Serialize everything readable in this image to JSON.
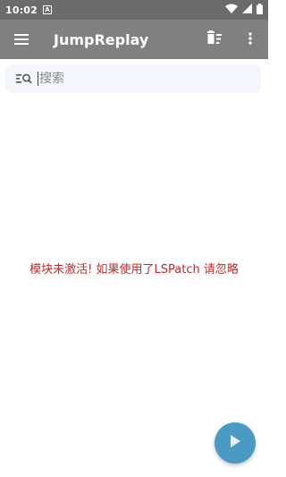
{
  "status_bar": {
    "time": "10:02",
    "notification_letter": "A",
    "icons": [
      "wifi-icon",
      "signal-icon",
      "battery-icon"
    ]
  },
  "app_bar": {
    "title": "JumpReplay",
    "menu_icon": "menu-icon",
    "actions": [
      "delete-sweep-icon",
      "more-vert-icon"
    ]
  },
  "search": {
    "placeholder": "搜索",
    "value": ""
  },
  "main": {
    "warning_text": "模块未激活! 如果使用了LSPatch 请忽略"
  },
  "fab": {
    "icon": "play-icon"
  },
  "colors": {
    "status_bar": "#6b6b6b",
    "app_bar": "#808080",
    "search_bg": "#f3f6fc",
    "warning": "#c62828",
    "fab": "#4a9bc4"
  }
}
